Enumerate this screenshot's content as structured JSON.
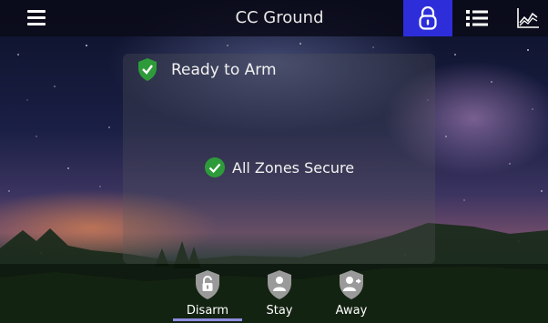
{
  "header": {
    "title": "CC Ground",
    "menu_icon": "hamburger-menu-icon",
    "tabs": [
      {
        "icon": "padlock-icon",
        "active": true
      },
      {
        "icon": "list-icon",
        "active": false
      },
      {
        "icon": "chart-icon",
        "active": false
      }
    ],
    "active_color": "#2d2eda"
  },
  "status": {
    "main": "Ready to Arm",
    "zones": "All Zones Secure",
    "ok_color": "#2e9b3a"
  },
  "arm_buttons": [
    {
      "label": "Disarm",
      "icon": "unlock-shield-icon",
      "selected": true
    },
    {
      "label": "Stay",
      "icon": "person-shield-icon",
      "selected": false
    },
    {
      "label": "Away",
      "icon": "person-leave-shield-icon",
      "selected": false
    }
  ]
}
